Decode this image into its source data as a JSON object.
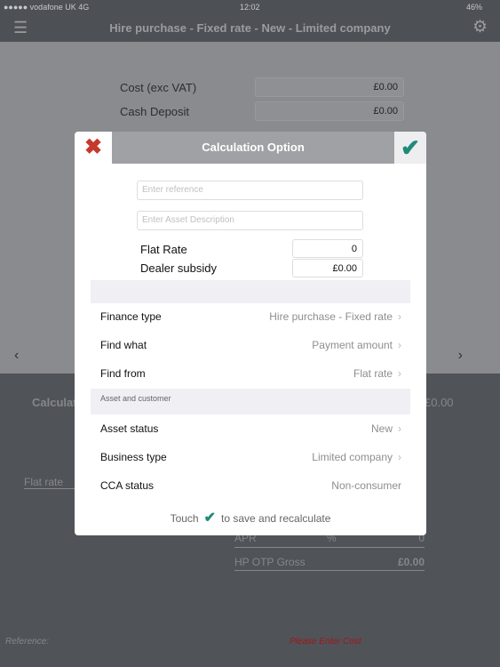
{
  "status_bar": {
    "carrier": "●●●●● vodafone UK  4G",
    "time": "12:02",
    "battery": "46%"
  },
  "nav": {
    "title": "Hire purchase - Fixed rate - New - Limited company",
    "menu_icon": "hamburger-icon",
    "settings_icon": "gear-icon"
  },
  "background": {
    "fields": [
      {
        "label": "Cost (exc VAT)",
        "value": "£0.00"
      },
      {
        "label": "Cash Deposit",
        "value": "£0.00"
      }
    ],
    "calculate_label": "Calculat",
    "calculate_value": "£0.00",
    "flat_rate": "Flat rate",
    "apr": {
      "label": "APR",
      "unit": "%",
      "value": "0"
    },
    "hp_otp": {
      "label": "HP OTP Gross",
      "value": "£0.00"
    },
    "reference": "Reference:",
    "warning": "Please Enter Cost",
    "warning_color": "#a01818"
  },
  "modal": {
    "title": "Calculation Option",
    "close_icon": "close-icon",
    "confirm_icon": "check-icon",
    "accent": "#1f8a7a",
    "close_color": "#c53a2c",
    "reference_placeholder": "Enter reference",
    "asset_placeholder": "Enter Asset Description",
    "flat_rate": {
      "label": "Flat Rate",
      "value": "0"
    },
    "dealer_subsidy": {
      "label": "Dealer subsidy",
      "value": "£0.00"
    },
    "items": [
      {
        "label": "Finance type",
        "value": "Hire purchase - Fixed rate"
      },
      {
        "label": "Find what",
        "value": "Payment amount"
      },
      {
        "label": "Find from",
        "value": "Flat rate"
      }
    ],
    "section": "Asset and customer",
    "items2": [
      {
        "label": "Asset status",
        "value": "New"
      },
      {
        "label": "Business type",
        "value": "Limited company"
      },
      {
        "label": "CCA status",
        "value": "Non-consumer"
      }
    ],
    "hint_before": "Touch",
    "hint_after": "to save and recalculate"
  }
}
